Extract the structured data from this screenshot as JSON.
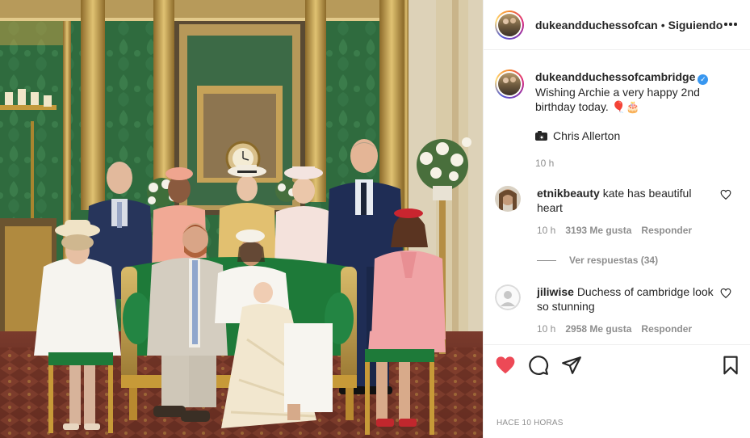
{
  "header": {
    "username": "dukeandduchessofcan",
    "separator": "•",
    "follow_status": "Siguiendo"
  },
  "caption": {
    "username": "dukeandduchessofcambridge",
    "verified_mark": "✓",
    "text_line1": "Wishing Archie a very happy 2nd",
    "text_line2": "birthday today.",
    "emoji": "🎈🎂",
    "photo_credit": "Chris Allerton",
    "time": "10 h"
  },
  "comments": [
    {
      "username": "etnikbeauty",
      "text": "kate has beautiful heart",
      "time": "10 h",
      "likes": "3193 Me gusta",
      "reply_label": "Responder"
    },
    {
      "username": "jiliwise",
      "text": "Duchess of cambridge look so stunning",
      "time": "10 h",
      "likes": "2958 Me gusta",
      "reply_label": "Responder"
    }
  ],
  "view_replies": "Ver respuestas (34)",
  "post_age": "HACE 10 HORAS",
  "colors": {
    "like_active": "#ed4956",
    "verified": "#3897f0",
    "secondary_text": "#8e8e8e",
    "photo_wall_green": "#2f6b3e",
    "photo_gold": "#c9a24a"
  },
  "icons": {
    "like": "heart-filled-icon",
    "comment": "comment-bubble-icon",
    "share": "paper-plane-icon",
    "save": "bookmark-icon",
    "more": "ellipsis-icon",
    "credit": "camera-icon"
  }
}
